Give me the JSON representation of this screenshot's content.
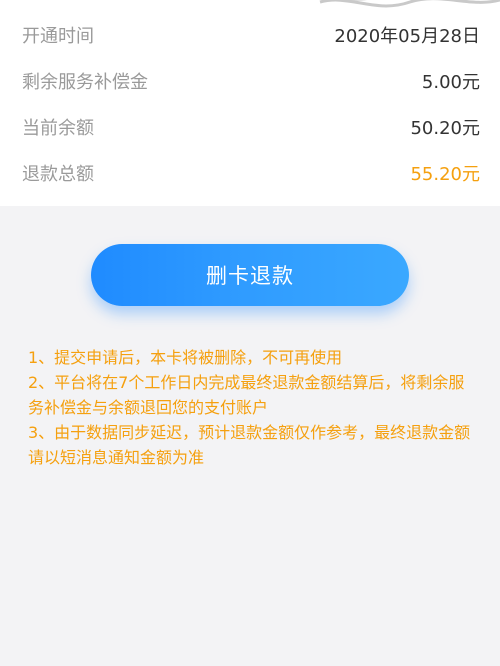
{
  "details": {
    "rows": [
      {
        "label": "开通时间",
        "value": "2020年05月28日"
      },
      {
        "label": "剩余服务补偿金",
        "value": "5.00元"
      },
      {
        "label": "当前余额",
        "value": "50.20元"
      },
      {
        "label": "退款总额",
        "value": "55.20元"
      }
    ]
  },
  "action": {
    "button_label": "删卡退款"
  },
  "notes": [
    "1、提交申请后，本卡将被删除，不可再使用",
    "2、平台将在7个工作日内完成最终退款金额结算后，将剩余服务补偿金与余额退回您的支付账户",
    "3、由于数据同步延迟，预计退款金额仅作参考，最终退款金额请以短消息通知金额为准"
  ],
  "colors": {
    "accent": "#f5a00f",
    "button": "#2f9bff",
    "label": "#9a9a9a",
    "value": "#333333"
  }
}
